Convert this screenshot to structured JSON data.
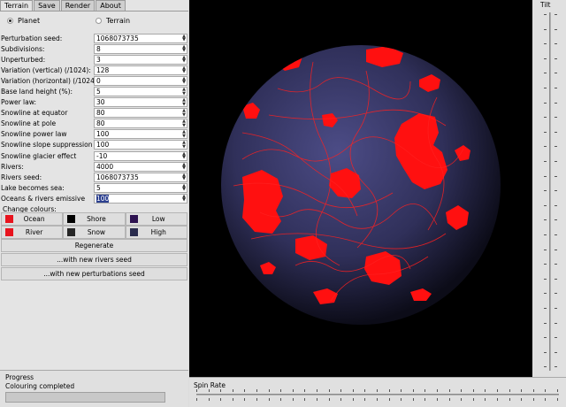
{
  "tabs": [
    {
      "label": "Terrain",
      "active": true
    },
    {
      "label": "Save",
      "active": false
    },
    {
      "label": "Render",
      "active": false
    },
    {
      "label": "About",
      "active": false
    }
  ],
  "mode": {
    "planet_label": "Planet",
    "terrain_label": "Terrain",
    "selected": "planet"
  },
  "fields": [
    {
      "label": "Perturbation seed:",
      "value": "1068073735"
    },
    {
      "label": "Subdivisions:",
      "value": "8"
    },
    {
      "label": "Unperturbed:",
      "value": "3"
    },
    {
      "label": "Variation (vertical) (/1024):",
      "value": "128"
    },
    {
      "label": "Variation (horizontal) (/1024):",
      "value": "0"
    },
    {
      "label": "Base land height (%):",
      "value": "5"
    },
    {
      "label": "Power law:",
      "value": "30"
    },
    {
      "label": "Snowline at equator",
      "value": "80"
    },
    {
      "label": "Snowline at pole",
      "value": "80"
    },
    {
      "label": "Snowline power law",
      "value": "100"
    },
    {
      "label": "Snowline slope suppression",
      "value": "100"
    },
    {
      "label": "Snowline glacier effect",
      "value": "-10"
    },
    {
      "label": "Rivers:",
      "value": "4000"
    },
    {
      "label": "Rivers seed:",
      "value": "1068073735"
    },
    {
      "label": "Lake becomes sea:",
      "value": "5"
    },
    {
      "label": "Oceans & rivers emissive",
      "value": "100"
    }
  ],
  "change_colours_label": "Change colours:",
  "colours": [
    [
      {
        "label": "Ocean",
        "color": "#e8141e"
      },
      {
        "label": "Shore",
        "color": "#000000"
      },
      {
        "label": "Low",
        "color": "#2d1250"
      }
    ],
    [
      {
        "label": "River",
        "color": "#e8141e"
      },
      {
        "label": "Snow",
        "color": "#262626"
      },
      {
        "label": "High",
        "color": "#2a2c4e"
      }
    ]
  ],
  "buttons": {
    "regenerate": "Regenerate",
    "new_rivers_seed": "...with new rivers seed",
    "new_perturbations_seed": "...with new perturbations seed"
  },
  "tilt_label": "Tilt",
  "progress": {
    "label": "Progress",
    "status": "Colouring completed",
    "fraction": 0
  },
  "spin_rate_label": "Spin Rate",
  "render_colors": {
    "land": "#3a3a66",
    "water": "#ff1010",
    "background": "#000000"
  }
}
